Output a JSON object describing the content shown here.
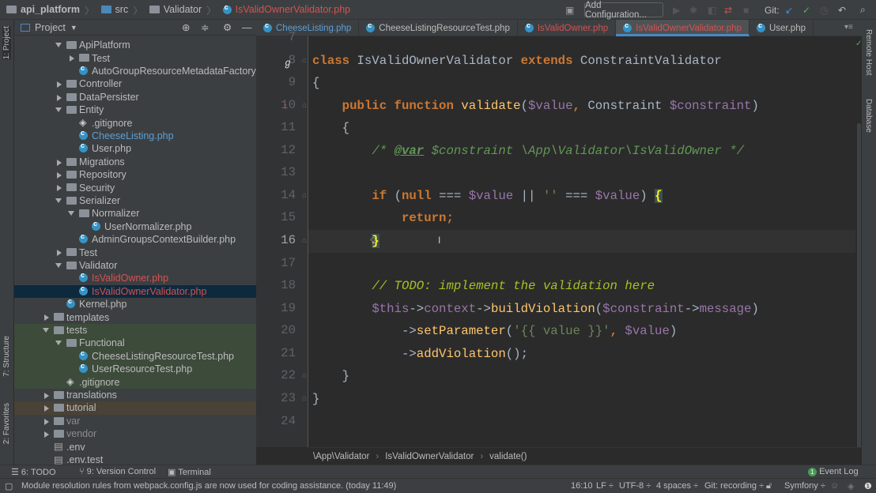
{
  "navbar": {
    "crumbs": [
      "api_platform",
      "src",
      "Validator",
      "IsValidOwnerValidator.php"
    ],
    "add_configuration": "Add Configuration...",
    "git_label": "Git:"
  },
  "left_tools": {
    "project": "1: Project",
    "structure": "7: Structure",
    "favorites": "2: Favorites"
  },
  "right_tools": {
    "remote_host": "Remote Host",
    "database": "Database"
  },
  "project_panel": {
    "title": "Project"
  },
  "tree": [
    {
      "label": "ApiPlatform",
      "depth": 2,
      "kind": "folder",
      "state": "open"
    },
    {
      "label": "Test",
      "depth": 3,
      "kind": "folder",
      "state": "closed"
    },
    {
      "label": "AutoGroupResourceMetadataFactory.php",
      "depth": 3,
      "kind": "php"
    },
    {
      "label": "Controller",
      "depth": 2,
      "kind": "folder",
      "state": "closed"
    },
    {
      "label": "DataPersister",
      "depth": 2,
      "kind": "folder",
      "state": "closed"
    },
    {
      "label": "Entity",
      "depth": 2,
      "kind": "folder",
      "state": "open"
    },
    {
      "label": ".gitignore",
      "depth": 3,
      "kind": "git"
    },
    {
      "label": "CheeseListing.php",
      "depth": 3,
      "kind": "php",
      "color": "#5c9fd6"
    },
    {
      "label": "User.php",
      "depth": 3,
      "kind": "php"
    },
    {
      "label": "Migrations",
      "depth": 2,
      "kind": "folder",
      "state": "closed"
    },
    {
      "label": "Repository",
      "depth": 2,
      "kind": "folder",
      "state": "closed"
    },
    {
      "label": "Security",
      "depth": 2,
      "kind": "folder",
      "state": "closed"
    },
    {
      "label": "Serializer",
      "depth": 2,
      "kind": "folder",
      "state": "open"
    },
    {
      "label": "Normalizer",
      "depth": 3,
      "kind": "folder",
      "state": "open"
    },
    {
      "label": "UserNormalizer.php",
      "depth": 4,
      "kind": "php"
    },
    {
      "label": "AdminGroupsContextBuilder.php",
      "depth": 3,
      "kind": "php"
    },
    {
      "label": "Test",
      "depth": 2,
      "kind": "folder",
      "state": "closed"
    },
    {
      "label": "Validator",
      "depth": 2,
      "kind": "folder",
      "state": "open"
    },
    {
      "label": "IsValidOwner.php",
      "depth": 3,
      "kind": "php",
      "color": "#d25252"
    },
    {
      "label": "IsValidOwnerValidator.php",
      "depth": 3,
      "kind": "php",
      "color": "#d25252",
      "selected": true
    },
    {
      "label": "Kernel.php",
      "depth": 2,
      "kind": "php"
    },
    {
      "label": "templates",
      "depth": 1,
      "kind": "folder",
      "state": "closed"
    },
    {
      "label": "tests",
      "depth": 1,
      "kind": "folder",
      "state": "open",
      "bg": "#3d4b3b"
    },
    {
      "label": "Functional",
      "depth": 2,
      "kind": "folder",
      "state": "open",
      "bg": "#3d4b3b"
    },
    {
      "label": "CheeseListingResourceTest.php",
      "depth": 3,
      "kind": "php",
      "bg": "#3d4b3b"
    },
    {
      "label": "UserResourceTest.php",
      "depth": 3,
      "kind": "php",
      "bg": "#3d4b3b"
    },
    {
      "label": ".gitignore",
      "depth": 2,
      "kind": "git",
      "bg": "#3d4b3b"
    },
    {
      "label": "translations",
      "depth": 1,
      "kind": "folder",
      "state": "closed"
    },
    {
      "label": "tutorial",
      "depth": 1,
      "kind": "folder",
      "state": "closed",
      "bg": "#4a4236"
    },
    {
      "label": "var",
      "depth": 1,
      "kind": "folder",
      "state": "closed",
      "color": "#8c8c8c"
    },
    {
      "label": "vendor",
      "depth": 1,
      "kind": "folder",
      "state": "closed",
      "color": "#8c8c8c"
    },
    {
      "label": ".env",
      "depth": 1,
      "kind": "file"
    },
    {
      "label": ".env.test",
      "depth": 1,
      "kind": "file"
    }
  ],
  "tabs": [
    {
      "label": "CheeseListing.php",
      "color": "#5c9fd6"
    },
    {
      "label": "CheeseListingResourceTest.php"
    },
    {
      "label": "IsValidOwner.php",
      "color": "#d25252"
    },
    {
      "label": "IsValidOwnerValidator.php",
      "color": "#d25252",
      "active": true
    },
    {
      "label": "User.php"
    }
  ],
  "editor": {
    "current_line": 16,
    "lines": [
      {
        "n": "7",
        "t": []
      },
      {
        "n": "8",
        "t": [
          [
            "class ",
            "kw"
          ],
          [
            "IsValidOwnerValidator ",
            "cls2"
          ],
          [
            "extends ",
            "kw"
          ],
          [
            "ConstraintValidator",
            "cls2"
          ]
        ]
      },
      {
        "n": "9",
        "t": [
          [
            "{",
            ""
          ]
        ]
      },
      {
        "n": "10",
        "t": [
          [
            "    ",
            ""
          ],
          [
            "public function ",
            "kw"
          ],
          [
            "validate",
            "fn"
          ],
          [
            "(",
            ""
          ],
          [
            "$value",
            "var"
          ],
          [
            ", ",
            "kw"
          ],
          [
            "Constraint ",
            ""
          ],
          [
            "$constraint",
            "var"
          ],
          [
            ")",
            ""
          ]
        ]
      },
      {
        "n": "11",
        "t": [
          [
            "    {",
            ""
          ]
        ]
      },
      {
        "n": "12",
        "t": [
          [
            "        ",
            ""
          ],
          [
            "/* ",
            "doc"
          ],
          [
            "@var",
            "doctag"
          ],
          [
            " $constraint \\App\\Validator\\IsValidOwner */",
            "doc"
          ]
        ]
      },
      {
        "n": "13",
        "t": []
      },
      {
        "n": "14",
        "t": [
          [
            "        ",
            ""
          ],
          [
            "if ",
            "kw"
          ],
          [
            "(",
            ""
          ],
          [
            "null ",
            "kw"
          ],
          [
            "=== ",
            ""
          ],
          [
            "$value",
            "var"
          ],
          [
            " || ",
            ""
          ],
          [
            "''",
            "str"
          ],
          [
            " === ",
            ""
          ],
          [
            "$value",
            "var"
          ],
          [
            ") ",
            ""
          ],
          [
            "{",
            "brace"
          ]
        ]
      },
      {
        "n": "15",
        "t": [
          [
            "            ",
            ""
          ],
          [
            "return;",
            "kw"
          ]
        ]
      },
      {
        "n": "16",
        "t": [
          [
            "        ",
            ""
          ],
          [
            "}",
            "brace"
          ]
        ]
      },
      {
        "n": "17",
        "t": []
      },
      {
        "n": "18",
        "t": [
          [
            "        ",
            ""
          ],
          [
            "// TODO: implement the validation here",
            "todo"
          ]
        ]
      },
      {
        "n": "19",
        "t": [
          [
            "        ",
            ""
          ],
          [
            "$this",
            "var"
          ],
          [
            "->",
            ""
          ],
          [
            "context",
            "var"
          ],
          [
            "->",
            ""
          ],
          [
            "buildViolation",
            "fn"
          ],
          [
            "(",
            ""
          ],
          [
            "$constraint",
            "var"
          ],
          [
            "->",
            ""
          ],
          [
            "message",
            "var"
          ],
          [
            ")",
            ""
          ]
        ]
      },
      {
        "n": "20",
        "t": [
          [
            "            ->",
            ""
          ],
          [
            "setParameter",
            "fn"
          ],
          [
            "(",
            ""
          ],
          [
            "'{{ value }}'",
            "str"
          ],
          [
            ", ",
            "kw"
          ],
          [
            "$value",
            "var"
          ],
          [
            ")",
            ""
          ]
        ]
      },
      {
        "n": "21",
        "t": [
          [
            "            ->",
            ""
          ],
          [
            "addViolation",
            "fn"
          ],
          [
            "();",
            ""
          ]
        ]
      },
      {
        "n": "22",
        "t": [
          [
            "    }",
            ""
          ]
        ]
      },
      {
        "n": "23",
        "t": [
          [
            "}",
            ""
          ]
        ]
      },
      {
        "n": "24",
        "t": []
      }
    ]
  },
  "breadcrumbs": [
    "\\App\\Validator",
    "IsValidOwnerValidator",
    "validate()"
  ],
  "tool_windows": {
    "todo": "6: TODO",
    "vcs": "9: Version Control",
    "terminal": "Terminal",
    "event_log": "Event Log",
    "event_count": "1"
  },
  "status": {
    "message": "Module resolution rules from webpack.config.js are now used for coding assistance. (today 11:49)",
    "position": "16:10",
    "line_sep": "LF ÷",
    "encoding": "UTF-8 ÷",
    "indent": "4 spaces ÷",
    "git": "Git: recording ÷",
    "framework": "Symfony ÷"
  }
}
